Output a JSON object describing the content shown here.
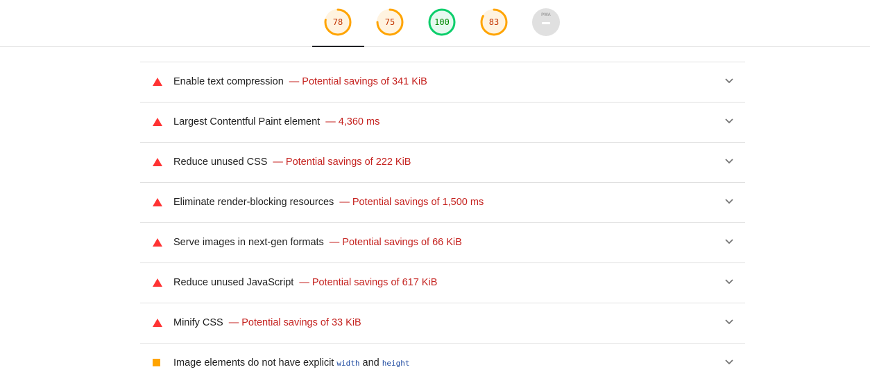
{
  "scores": [
    {
      "value": "78",
      "category": "performance",
      "score": 0.78,
      "status": "average"
    },
    {
      "value": "75",
      "category": "accessibility",
      "score": 0.75,
      "status": "average"
    },
    {
      "value": "100",
      "category": "best-practices",
      "score": 1.0,
      "status": "pass"
    },
    {
      "value": "83",
      "category": "seo",
      "score": 0.83,
      "status": "average"
    },
    {
      "value": "PWA",
      "category": "pwa",
      "status": "na"
    }
  ],
  "active_tab": "performance",
  "colors": {
    "average": "#ffa400",
    "average_bg": "#fff3e0",
    "average_text": "#c33300",
    "pass": "#0cce6b",
    "pass_bg": "#e6f9ef",
    "pass_text": "#008800",
    "na": "#e0e0e0",
    "fail": "#ff3333",
    "display_value": "#c5221f"
  },
  "audits": [
    {
      "title": "Enable text compression",
      "separator": "—",
      "display": "Potential savings of 341 KiB",
      "status": "fail"
    },
    {
      "title": "Largest Contentful Paint element",
      "separator": "—",
      "display": "4,360 ms",
      "status": "fail"
    },
    {
      "title": "Reduce unused CSS",
      "separator": "—",
      "display": "Potential savings of 222 KiB",
      "status": "fail"
    },
    {
      "title": "Eliminate render-blocking resources",
      "separator": "—",
      "display": "Potential savings of 1,500 ms",
      "status": "fail"
    },
    {
      "title": "Serve images in next-gen formats",
      "separator": "—",
      "display": "Potential savings of 66 KiB",
      "status": "fail"
    },
    {
      "title": "Reduce unused JavaScript",
      "separator": "—",
      "display": "Potential savings of 617 KiB",
      "status": "fail"
    },
    {
      "title": "Minify CSS",
      "separator": "—",
      "display": "Potential savings of 33 KiB",
      "status": "fail"
    },
    {
      "title_prefix": "Image elements do not have explicit",
      "code1": "width",
      "and": "and",
      "code2": "height",
      "status": "average"
    }
  ],
  "icons": {
    "fail": "triangle-warning-icon",
    "average": "orange-square-icon",
    "expand": "chevron-down-icon"
  }
}
